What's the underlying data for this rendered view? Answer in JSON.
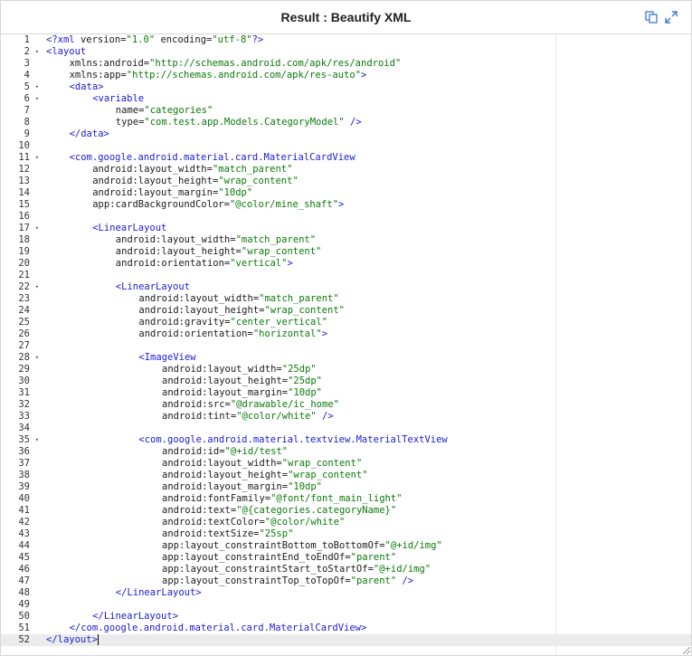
{
  "header": {
    "title": "Result : Beautify XML",
    "copy_icon": "copy-icon",
    "expand_icon": "expand-icon"
  },
  "colors": {
    "tag": "#1b1bd8",
    "string": "#0b7a0b",
    "text": "#1b1b1b",
    "active_line": "#ebebeb"
  },
  "editor": {
    "active_line": 52,
    "lines": [
      {
        "n": "1",
        "fold": false,
        "ind": 0,
        "parts": [
          [
            "t",
            "<?xml "
          ],
          [
            "a",
            "version="
          ],
          [
            "s",
            "\"1.0\""
          ],
          [
            "a",
            " encoding="
          ],
          [
            "s",
            "\"utf-8\""
          ],
          [
            "t",
            "?>"
          ]
        ]
      },
      {
        "n": "2",
        "fold": true,
        "ind": 0,
        "parts": [
          [
            "t",
            "<layout"
          ]
        ]
      },
      {
        "n": "3",
        "fold": false,
        "ind": 4,
        "parts": [
          [
            "a",
            "xmlns:android="
          ],
          [
            "s",
            "\"http://schemas.android.com/apk/res/android\""
          ]
        ]
      },
      {
        "n": "4",
        "fold": false,
        "ind": 4,
        "parts": [
          [
            "a",
            "xmlns:app="
          ],
          [
            "s",
            "\"http://schemas.android.com/apk/res-auto\""
          ],
          [
            "t",
            ">"
          ]
        ]
      },
      {
        "n": "5",
        "fold": true,
        "ind": 4,
        "parts": [
          [
            "t",
            "<data>"
          ]
        ]
      },
      {
        "n": "6",
        "fold": true,
        "ind": 8,
        "parts": [
          [
            "t",
            "<variable"
          ]
        ]
      },
      {
        "n": "7",
        "fold": false,
        "ind": 12,
        "parts": [
          [
            "a",
            "name="
          ],
          [
            "s",
            "\"categories\""
          ]
        ]
      },
      {
        "n": "8",
        "fold": false,
        "ind": 12,
        "parts": [
          [
            "a",
            "type="
          ],
          [
            "s",
            "\"com.test.app.Models.CategoryModel\""
          ],
          [
            "t",
            " />"
          ]
        ]
      },
      {
        "n": "9",
        "fold": false,
        "ind": 4,
        "parts": [
          [
            "t",
            "</data>"
          ]
        ]
      },
      {
        "n": "10",
        "fold": false,
        "ind": 0,
        "parts": []
      },
      {
        "n": "11",
        "fold": true,
        "ind": 4,
        "parts": [
          [
            "t",
            "<com.google.android.material.card.MaterialCardView"
          ]
        ]
      },
      {
        "n": "12",
        "fold": false,
        "ind": 8,
        "parts": [
          [
            "a",
            "android:layout_width="
          ],
          [
            "s",
            "\"match_parent\""
          ]
        ]
      },
      {
        "n": "13",
        "fold": false,
        "ind": 8,
        "parts": [
          [
            "a",
            "android:layout_height="
          ],
          [
            "s",
            "\"wrap_content\""
          ]
        ]
      },
      {
        "n": "14",
        "fold": false,
        "ind": 8,
        "parts": [
          [
            "a",
            "android:layout_margin="
          ],
          [
            "s",
            "\"10dp\""
          ]
        ]
      },
      {
        "n": "15",
        "fold": false,
        "ind": 8,
        "parts": [
          [
            "a",
            "app:cardBackgroundColor="
          ],
          [
            "s",
            "\"@color/mine_shaft\""
          ],
          [
            "t",
            ">"
          ]
        ]
      },
      {
        "n": "16",
        "fold": false,
        "ind": 0,
        "parts": []
      },
      {
        "n": "17",
        "fold": true,
        "ind": 8,
        "parts": [
          [
            "t",
            "<LinearLayout"
          ]
        ]
      },
      {
        "n": "18",
        "fold": false,
        "ind": 12,
        "parts": [
          [
            "a",
            "android:layout_width="
          ],
          [
            "s",
            "\"match_parent\""
          ]
        ]
      },
      {
        "n": "19",
        "fold": false,
        "ind": 12,
        "parts": [
          [
            "a",
            "android:layout_height="
          ],
          [
            "s",
            "\"wrap_content\""
          ]
        ]
      },
      {
        "n": "20",
        "fold": false,
        "ind": 12,
        "parts": [
          [
            "a",
            "android:orientation="
          ],
          [
            "s",
            "\"vertical\""
          ],
          [
            "t",
            ">"
          ]
        ]
      },
      {
        "n": "21",
        "fold": false,
        "ind": 0,
        "parts": []
      },
      {
        "n": "22",
        "fold": true,
        "ind": 12,
        "parts": [
          [
            "t",
            "<LinearLayout"
          ]
        ]
      },
      {
        "n": "23",
        "fold": false,
        "ind": 16,
        "parts": [
          [
            "a",
            "android:layout_width="
          ],
          [
            "s",
            "\"match_parent\""
          ]
        ]
      },
      {
        "n": "24",
        "fold": false,
        "ind": 16,
        "parts": [
          [
            "a",
            "android:layout_height="
          ],
          [
            "s",
            "\"wrap_content\""
          ]
        ]
      },
      {
        "n": "25",
        "fold": false,
        "ind": 16,
        "parts": [
          [
            "a",
            "android:gravity="
          ],
          [
            "s",
            "\"center_vertical\""
          ]
        ]
      },
      {
        "n": "26",
        "fold": false,
        "ind": 16,
        "parts": [
          [
            "a",
            "android:orientation="
          ],
          [
            "s",
            "\"horizontal\""
          ],
          [
            "t",
            ">"
          ]
        ]
      },
      {
        "n": "27",
        "fold": false,
        "ind": 0,
        "parts": []
      },
      {
        "n": "28",
        "fold": true,
        "ind": 16,
        "parts": [
          [
            "t",
            "<ImageView"
          ]
        ]
      },
      {
        "n": "29",
        "fold": false,
        "ind": 20,
        "parts": [
          [
            "a",
            "android:layout_width="
          ],
          [
            "s",
            "\"25dp\""
          ]
        ]
      },
      {
        "n": "30",
        "fold": false,
        "ind": 20,
        "parts": [
          [
            "a",
            "android:layout_height="
          ],
          [
            "s",
            "\"25dp\""
          ]
        ]
      },
      {
        "n": "31",
        "fold": false,
        "ind": 20,
        "parts": [
          [
            "a",
            "android:layout_margin="
          ],
          [
            "s",
            "\"10dp\""
          ]
        ]
      },
      {
        "n": "32",
        "fold": false,
        "ind": 20,
        "parts": [
          [
            "a",
            "android:src="
          ],
          [
            "s",
            "\"@drawable/ic_home\""
          ]
        ]
      },
      {
        "n": "33",
        "fold": false,
        "ind": 20,
        "parts": [
          [
            "a",
            "android:tint="
          ],
          [
            "s",
            "\"@color/white\""
          ],
          [
            "t",
            " />"
          ]
        ]
      },
      {
        "n": "34",
        "fold": false,
        "ind": 0,
        "parts": []
      },
      {
        "n": "35",
        "fold": true,
        "ind": 16,
        "parts": [
          [
            "t",
            "<com.google.android.material.textview.MaterialTextView"
          ]
        ]
      },
      {
        "n": "36",
        "fold": false,
        "ind": 20,
        "parts": [
          [
            "a",
            "android:id="
          ],
          [
            "s",
            "\"@+id/test\""
          ]
        ]
      },
      {
        "n": "37",
        "fold": false,
        "ind": 20,
        "parts": [
          [
            "a",
            "android:layout_width="
          ],
          [
            "s",
            "\"wrap_content\""
          ]
        ]
      },
      {
        "n": "38",
        "fold": false,
        "ind": 20,
        "parts": [
          [
            "a",
            "android:layout_height="
          ],
          [
            "s",
            "\"wrap_content\""
          ]
        ]
      },
      {
        "n": "39",
        "fold": false,
        "ind": 20,
        "parts": [
          [
            "a",
            "android:layout_margin="
          ],
          [
            "s",
            "\"10dp\""
          ]
        ]
      },
      {
        "n": "40",
        "fold": false,
        "ind": 20,
        "parts": [
          [
            "a",
            "android:fontFamily="
          ],
          [
            "s",
            "\"@font/font_main_light\""
          ]
        ]
      },
      {
        "n": "41",
        "fold": false,
        "ind": 20,
        "parts": [
          [
            "a",
            "android:text="
          ],
          [
            "s",
            "\"@{categories.categoryName}\""
          ]
        ]
      },
      {
        "n": "42",
        "fold": false,
        "ind": 20,
        "parts": [
          [
            "a",
            "android:textColor="
          ],
          [
            "s",
            "\"@color/white\""
          ]
        ]
      },
      {
        "n": "43",
        "fold": false,
        "ind": 20,
        "parts": [
          [
            "a",
            "android:textSize="
          ],
          [
            "s",
            "\"25sp\""
          ]
        ]
      },
      {
        "n": "44",
        "fold": false,
        "ind": 20,
        "parts": [
          [
            "a",
            "app:layout_constraintBottom_toBottomOf="
          ],
          [
            "s",
            "\"@+id/img\""
          ]
        ]
      },
      {
        "n": "45",
        "fold": false,
        "ind": 20,
        "parts": [
          [
            "a",
            "app:layout_constraintEnd_toEndOf="
          ],
          [
            "s",
            "\"parent\""
          ]
        ]
      },
      {
        "n": "46",
        "fold": false,
        "ind": 20,
        "parts": [
          [
            "a",
            "app:layout_constraintStart_toStartOf="
          ],
          [
            "s",
            "\"@+id/img\""
          ]
        ]
      },
      {
        "n": "47",
        "fold": false,
        "ind": 20,
        "parts": [
          [
            "a",
            "app:layout_constraintTop_toTopOf="
          ],
          [
            "s",
            "\"parent\""
          ],
          [
            "t",
            " />"
          ]
        ]
      },
      {
        "n": "48",
        "fold": false,
        "ind": 12,
        "parts": [
          [
            "t",
            "</LinearLayout>"
          ]
        ]
      },
      {
        "n": "49",
        "fold": false,
        "ind": 0,
        "parts": []
      },
      {
        "n": "50",
        "fold": false,
        "ind": 8,
        "parts": [
          [
            "t",
            "</LinearLayout>"
          ]
        ]
      },
      {
        "n": "51",
        "fold": false,
        "ind": 4,
        "parts": [
          [
            "t",
            "</com.google.android.material.card.MaterialCardView>"
          ]
        ]
      },
      {
        "n": "52",
        "fold": false,
        "ind": 0,
        "parts": [
          [
            "t",
            "</layout>"
          ]
        ]
      }
    ]
  }
}
